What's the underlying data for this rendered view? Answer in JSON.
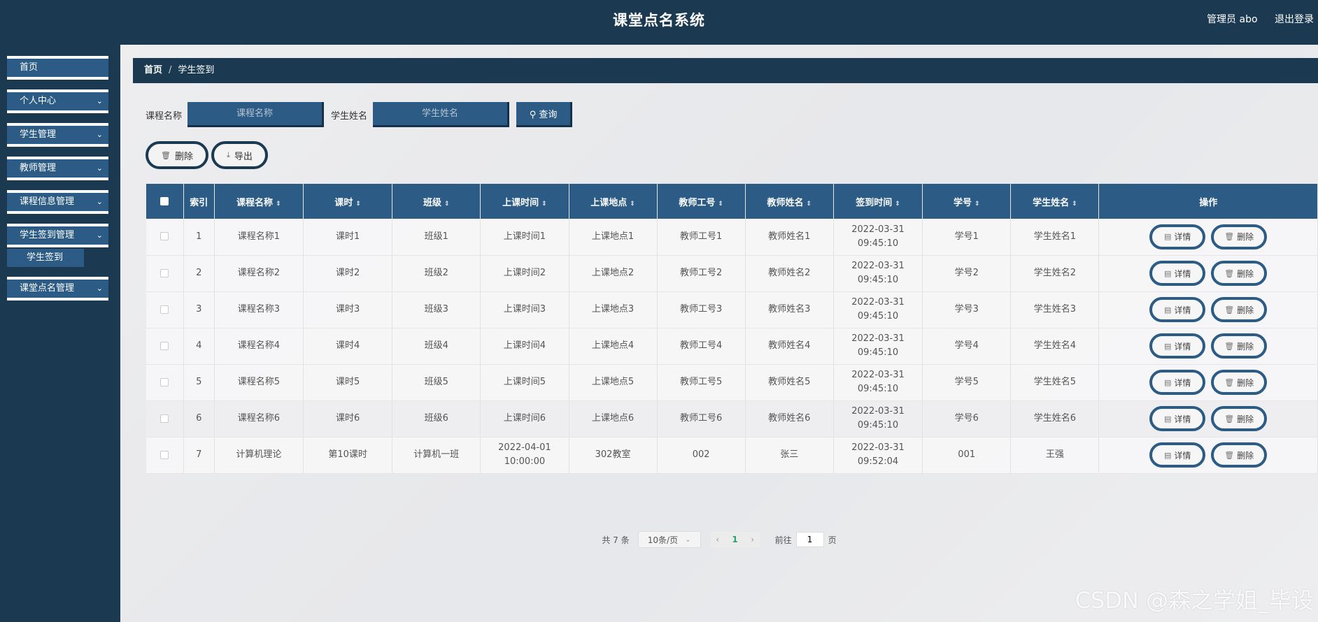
{
  "header": {
    "title": "课堂点名系统",
    "user": "管理员 abo",
    "logout": "退出登录"
  },
  "sidebar": {
    "items": [
      {
        "label": "首页",
        "has_children": false
      },
      {
        "label": "个人中心",
        "has_children": true
      },
      {
        "label": "学生管理",
        "has_children": true
      },
      {
        "label": "教师管理",
        "has_children": true
      },
      {
        "label": "课程信息管理",
        "has_children": true
      },
      {
        "label": "学生签到管理",
        "has_children": true
      },
      {
        "label": "课堂点名管理",
        "has_children": true
      }
    ],
    "sub_item": "学生签到"
  },
  "breadcrumb": {
    "home": "首页",
    "separator": "/",
    "current": "学生签到"
  },
  "search": {
    "course_label": "课程名称",
    "course_placeholder": "课程名称",
    "student_label": "学生姓名",
    "student_placeholder": "学生姓名",
    "query_label": "查询"
  },
  "actions": {
    "delete_label": "删除",
    "export_label": "导出"
  },
  "table": {
    "columns": [
      "索引",
      "课程名称",
      "课时",
      "班级",
      "上课时间",
      "上课地点",
      "教师工号",
      "教师姓名",
      "签到时间",
      "学号",
      "学生姓名",
      "操作"
    ],
    "rows": [
      [
        "1",
        "课程名称1",
        "课时1",
        "班级1",
        "上课时间1",
        "上课地点1",
        "教师工号1",
        "教师姓名1",
        "2022-03-31 09:45:10",
        "学号1",
        "学生姓名1"
      ],
      [
        "2",
        "课程名称2",
        "课时2",
        "班级2",
        "上课时间2",
        "上课地点2",
        "教师工号2",
        "教师姓名2",
        "2022-03-31 09:45:10",
        "学号2",
        "学生姓名2"
      ],
      [
        "3",
        "课程名称3",
        "课时3",
        "班级3",
        "上课时间3",
        "上课地点3",
        "教师工号3",
        "教师姓名3",
        "2022-03-31 09:45:10",
        "学号3",
        "学生姓名3"
      ],
      [
        "4",
        "课程名称4",
        "课时4",
        "班级4",
        "上课时间4",
        "上课地点4",
        "教师工号4",
        "教师姓名4",
        "2022-03-31 09:45:10",
        "学号4",
        "学生姓名4"
      ],
      [
        "5",
        "课程名称5",
        "课时5",
        "班级5",
        "上课时间5",
        "上课地点5",
        "教师工号5",
        "教师姓名5",
        "2022-03-31 09:45:10",
        "学号5",
        "学生姓名5"
      ],
      [
        "6",
        "课程名称6",
        "课时6",
        "班级6",
        "上课时间6",
        "上课地点6",
        "教师工号6",
        "教师姓名6",
        "2022-03-31 09:45:10",
        "学号6",
        "学生姓名6"
      ],
      [
        "7",
        "计算机理论",
        "第10课时",
        "计算机一班",
        "2022-04-01 10:00:00",
        "302教室",
        "002",
        "张三",
        "2022-03-31 09:52:04",
        "001",
        "王强"
      ]
    ],
    "detail_label": "详情",
    "delete_label": "删除"
  },
  "pagination": {
    "total": "共 7 条",
    "page_size": "10条/页",
    "current_page": "1",
    "goto_label": "前往",
    "goto_value": "1",
    "page_unit": "页"
  },
  "watermark": "CSDN @森之学姐_毕设"
}
